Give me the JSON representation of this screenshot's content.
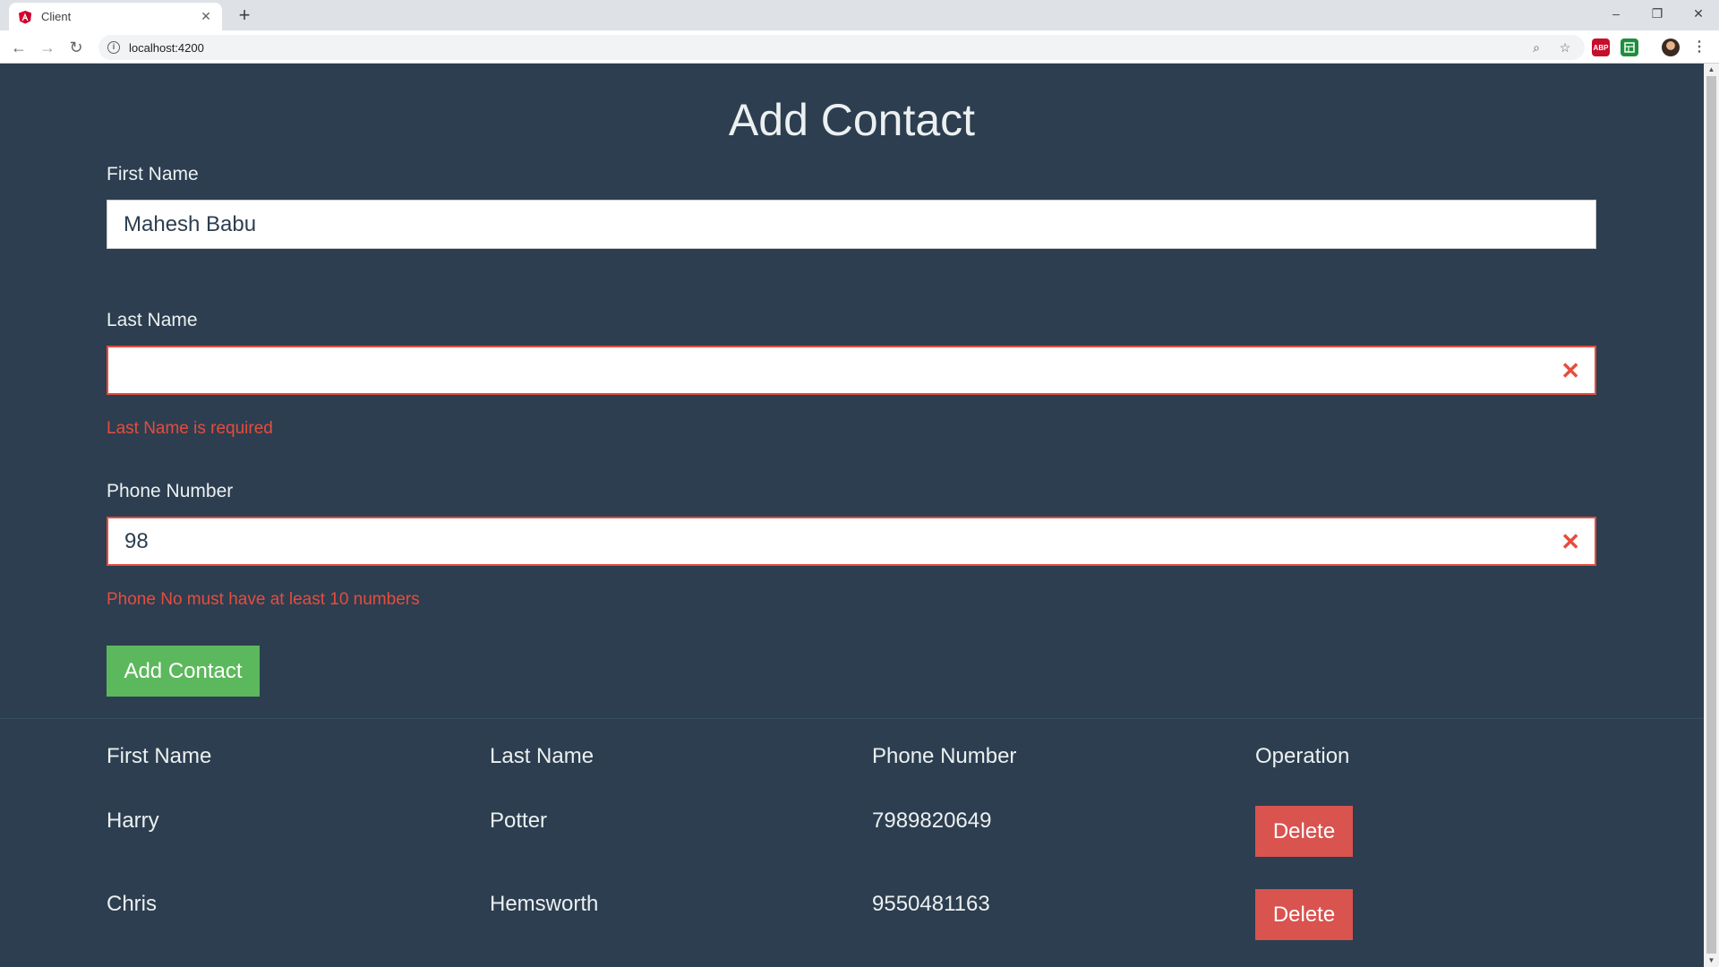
{
  "browser": {
    "tab_title": "Client",
    "new_tab": "+",
    "url": "localhost:4200",
    "window_controls": {
      "minimize": "–",
      "restore": "❐",
      "close": "✕"
    },
    "extensions": [
      {
        "label": "ABP",
        "color": "#c70d2c"
      },
      {
        "label": "",
        "color": "#1e8e3e"
      }
    ]
  },
  "form": {
    "title": "Add Contact",
    "first_name": {
      "label": "First Name",
      "value": "Mahesh Babu"
    },
    "last_name": {
      "label": "Last Name",
      "value": "",
      "error": "Last Name is required"
    },
    "phone": {
      "label": "Phone Number",
      "value": "98",
      "error": "Phone No must have at least 10 numbers"
    },
    "submit_label": "Add Contact"
  },
  "table": {
    "headers": [
      "First Name",
      "Last Name",
      "Phone Number",
      "Operation"
    ],
    "rows": [
      {
        "first": "Harry",
        "last": "Potter",
        "phone": "7989820649",
        "action": "Delete"
      },
      {
        "first": "Chris",
        "last": "Hemsworth",
        "phone": "9550481163",
        "action": "Delete"
      }
    ]
  },
  "colors": {
    "page_bg": "#2c3e50",
    "error": "#e74c3c",
    "success": "#5cb85c",
    "danger": "#d9534f"
  }
}
